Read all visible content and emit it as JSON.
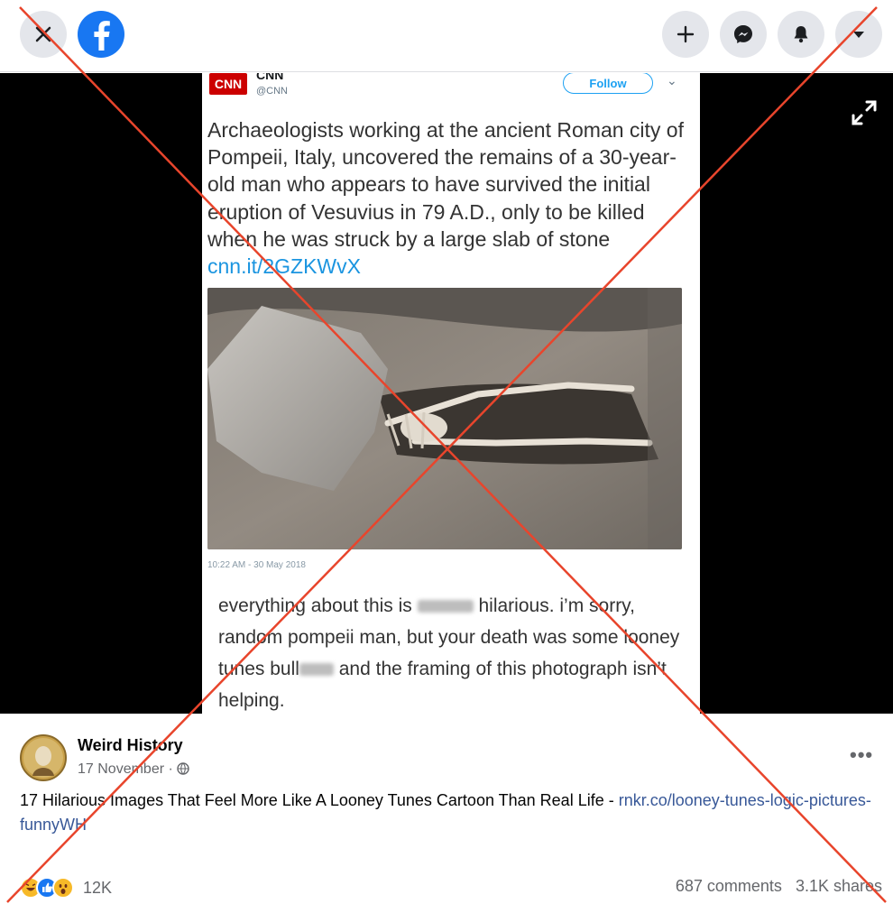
{
  "topbar": {
    "close_icon": "close-icon",
    "logo_icon": "facebook-logo-icon",
    "actions": [
      "plus-icon",
      "messenger-icon",
      "bell-icon",
      "caret-down-icon"
    ]
  },
  "tweet": {
    "brand": "CNN",
    "account_name": "CNN",
    "handle": "@CNN",
    "follow_label": "Follow",
    "text": "Archaeologists working at the ancient Roman city of Pompeii, Italy, uncovered the remains of a 30-year-old man who appears to have survived the initial eruption of Vesuvius in 79 A.D., only to be killed when he was struck by a large slab of stone",
    "link": "cnn.it/2GZKWvX",
    "timestamp": "10:22 AM - 30 May 2018"
  },
  "caption": {
    "part1": "everything about this is",
    "part2": "hilarious. i’m sorry, random pompeii man, but your death was some looney tunes bull",
    "part3": "and the framing of this photograph isn’t helping."
  },
  "post": {
    "page_name": "Weird History",
    "date": "17 November",
    "date_separator": "·",
    "text": "17 Hilarious Images That Feel More Like A Looney Tunes Cartoon Than Real Life - ",
    "link": "rnkr.co/looney-tunes-logic-pictures-funnyWH",
    "more": "•••"
  },
  "engagement": {
    "reaction_icons": [
      "haha-icon",
      "like-icon",
      "wow-icon"
    ],
    "reaction_count": "12K",
    "comments": "687 comments",
    "shares": "3.1K shares"
  },
  "colors": {
    "facebook_blue": "#1877f2",
    "cross_red": "#e8452c",
    "link_blue": "#385898",
    "twitter_blue": "#1da1f2"
  }
}
